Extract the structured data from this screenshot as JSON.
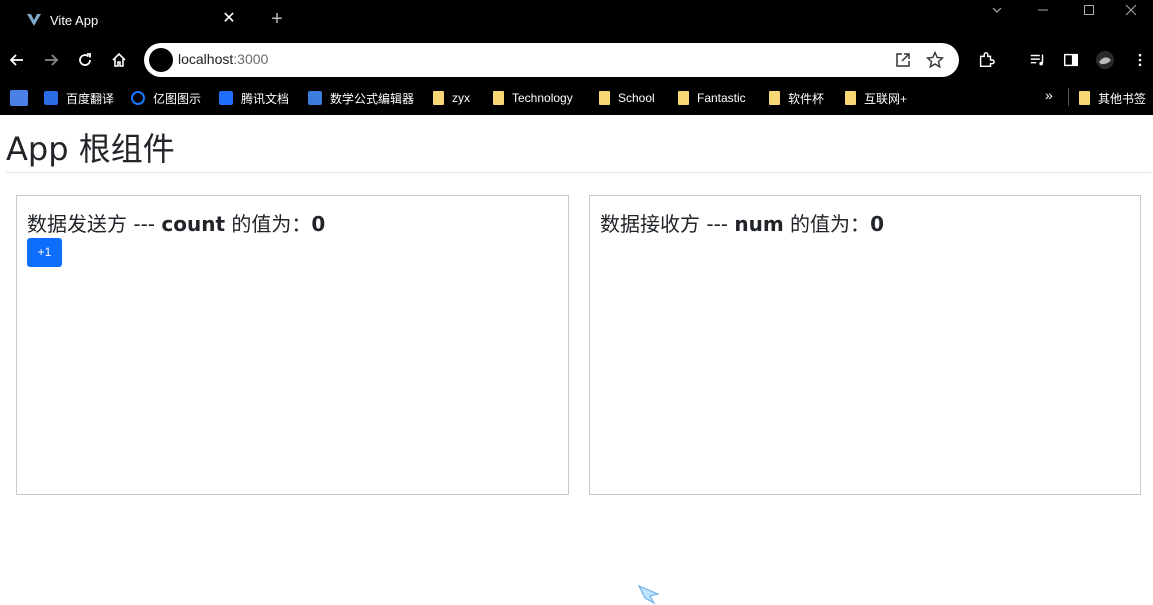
{
  "browser": {
    "tab": {
      "title": "Vite App",
      "close_glyph": "✕"
    },
    "new_tab_glyph": "+",
    "address": {
      "host": "localhost",
      "port": ":3000"
    },
    "bookmarks": [
      {
        "label": "百度翻译",
        "icon": "translate-icon",
        "color": "#2b6de4"
      },
      {
        "label": "亿图图示",
        "icon": "edraw-icon",
        "color": "#1677ff"
      },
      {
        "label": "腾讯文档",
        "icon": "tencent-docs-icon",
        "color": "#1e6fff"
      },
      {
        "label": "数学公式编辑器",
        "icon": "formula-editor-icon",
        "color": "#3b7ddd"
      },
      {
        "label": "zyx",
        "icon": "folder-icon"
      },
      {
        "label": "Technology",
        "icon": "folder-icon"
      },
      {
        "label": "School",
        "icon": "folder-icon"
      },
      {
        "label": "Fantastic",
        "icon": "folder-icon"
      },
      {
        "label": "软件杯",
        "icon": "folder-icon"
      },
      {
        "label": "互联网+",
        "icon": "folder-icon"
      }
    ],
    "bookmarks_overflow": "»",
    "other_bookmarks": "其他书签"
  },
  "page": {
    "title": "App 根组件",
    "sender": {
      "prefix": "数据发送方 --- ",
      "var_name": "count",
      "middle": " 的值为：",
      "value": "0",
      "button_label": "+1"
    },
    "receiver": {
      "prefix": "数据接收方 --- ",
      "var_name": "num",
      "middle": " 的值为：",
      "value": "0"
    }
  },
  "colors": {
    "accent": "#0d6efd",
    "chrome": "#000000",
    "folder": "#f8d775"
  }
}
